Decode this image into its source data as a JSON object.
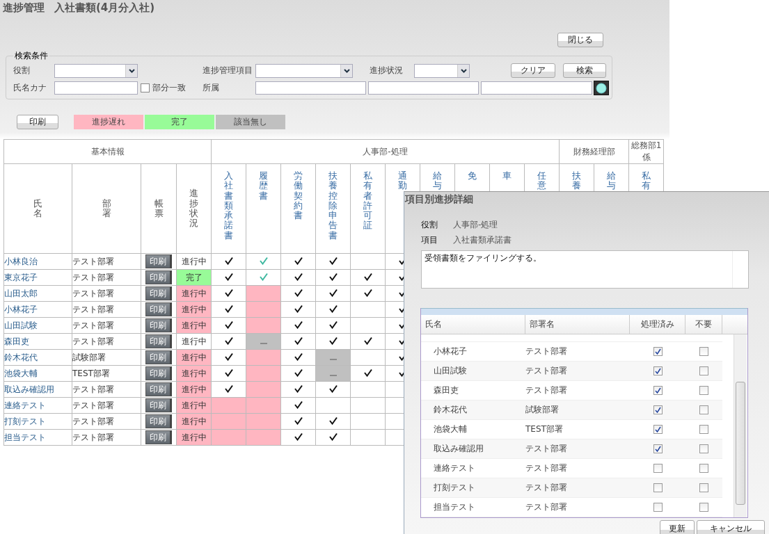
{
  "title": {
    "module": "進捗管理",
    "document": "入社書類(4月分入社)"
  },
  "close_button": "閉じる",
  "search": {
    "legend": "検索条件",
    "role_label": "役割",
    "item_label": "進捗管理項目",
    "status_label": "進捗状況",
    "kana_label": "氏名カナ",
    "partial_match": {
      "label": "部分一致",
      "checked": false
    },
    "affiliation_label": "所属",
    "buttons": [
      "クリア",
      "検索"
    ]
  },
  "legend": {
    "print_button": "印刷",
    "items": [
      {
        "label": "進捗遅れ",
        "kind": "late"
      },
      {
        "label": "完了",
        "kind": "done"
      },
      {
        "label": "該当無し",
        "kind": "na"
      }
    ]
  },
  "table": {
    "groups": [
      {
        "label": "基本情報",
        "columns": [
          "氏名",
          "部署",
          "帳票",
          "進捗状況"
        ]
      },
      {
        "label": "人事部-処理",
        "columns": [
          "入社書類承諾書",
          "履歴書",
          "労働契約書",
          "扶養控除申告書",
          "私有者許可証",
          "通勤",
          "給与",
          "免",
          "車",
          "任意"
        ]
      },
      {
        "label": "財務経理部",
        "columns": [
          "扶養",
          "給与"
        ]
      },
      {
        "label": "総務部1係",
        "columns": [
          "私有"
        ]
      }
    ],
    "rows": [
      {
        "name": "小林良治",
        "dept": "テスト部署",
        "print": "印刷",
        "status": {
          "text": "進行中",
          "kind": "normal"
        },
        "docs": [
          {
            "kind": "check"
          },
          {
            "kind": "confirmed"
          },
          {
            "kind": "check"
          },
          {
            "kind": "check"
          },
          {
            "kind": "blank"
          },
          {
            "kind": "check"
          }
        ]
      },
      {
        "name": "東京花子",
        "dept": "テスト部署",
        "print": "印刷",
        "status": {
          "text": "完了",
          "kind": "done"
        },
        "docs": [
          {
            "kind": "check"
          },
          {
            "kind": "confirmed"
          },
          {
            "kind": "check"
          },
          {
            "kind": "check"
          },
          {
            "kind": "check"
          },
          {
            "kind": "check"
          }
        ]
      },
      {
        "name": "山田太郎",
        "dept": "テスト部署",
        "print": "印刷",
        "status": {
          "text": "進行中",
          "kind": "late"
        },
        "docs": [
          {
            "kind": "check"
          },
          {
            "kind": "late"
          },
          {
            "kind": "check"
          },
          {
            "kind": "check"
          },
          {
            "kind": "check"
          },
          {
            "kind": "check"
          }
        ]
      },
      {
        "name": "小林花子",
        "dept": "テスト部署",
        "print": "印刷",
        "status": {
          "text": "進行中",
          "kind": "late"
        },
        "docs": [
          {
            "kind": "check"
          },
          {
            "kind": "late"
          },
          {
            "kind": "check"
          },
          {
            "kind": "check"
          },
          {
            "kind": "blank"
          },
          {
            "kind": "check"
          }
        ]
      },
      {
        "name": "山田試験",
        "dept": "テスト部署",
        "print": "印刷",
        "status": {
          "text": "進行中",
          "kind": "late"
        },
        "docs": [
          {
            "kind": "check"
          },
          {
            "kind": "late"
          },
          {
            "kind": "check"
          },
          {
            "kind": "check"
          },
          {
            "kind": "blank"
          },
          {
            "kind": "check"
          }
        ]
      },
      {
        "name": "森田吏",
        "dept": "テスト部署",
        "print": "印刷",
        "status": {
          "text": "進行中",
          "kind": "normal"
        },
        "docs": [
          {
            "kind": "check"
          },
          {
            "kind": "na"
          },
          {
            "kind": "check"
          },
          {
            "kind": "check"
          },
          {
            "kind": "check"
          },
          {
            "kind": "check"
          }
        ]
      },
      {
        "name": "鈴木花代",
        "dept": "試験部署",
        "print": "印刷",
        "status": {
          "text": "進行中",
          "kind": "late"
        },
        "docs": [
          {
            "kind": "check"
          },
          {
            "kind": "late"
          },
          {
            "kind": "check"
          },
          {
            "kind": "na"
          },
          {
            "kind": "blank"
          },
          {
            "kind": "check"
          }
        ]
      },
      {
        "name": "池袋大輔",
        "dept": "TEST部署",
        "print": "印刷",
        "status": {
          "text": "進行中",
          "kind": "late"
        },
        "docs": [
          {
            "kind": "check"
          },
          {
            "kind": "late"
          },
          {
            "kind": "check"
          },
          {
            "kind": "na"
          },
          {
            "kind": "check"
          },
          {
            "kind": "check"
          }
        ]
      },
      {
        "name": "取込み確認用",
        "dept": "テスト部署",
        "print": "印刷",
        "status": {
          "text": "進行中",
          "kind": "late"
        },
        "docs": [
          {
            "kind": "check"
          },
          {
            "kind": "late"
          },
          {
            "kind": "check"
          },
          {
            "kind": "check"
          },
          {
            "kind": "blank"
          },
          {
            "kind": "blank"
          }
        ]
      },
      {
        "name": "連絡テスト",
        "dept": "テスト部署",
        "print": "印刷",
        "status": {
          "text": "進行中",
          "kind": "late"
        },
        "docs": [
          {
            "kind": "late"
          },
          {
            "kind": "late"
          },
          {
            "kind": "check"
          },
          {
            "kind": "blank"
          },
          {
            "kind": "blank"
          },
          {
            "kind": "blank"
          }
        ]
      },
      {
        "name": "打刻テスト",
        "dept": "テスト部署",
        "print": "印刷",
        "status": {
          "text": "進行中",
          "kind": "late"
        },
        "docs": [
          {
            "kind": "late"
          },
          {
            "kind": "late"
          },
          {
            "kind": "check"
          },
          {
            "kind": "check"
          },
          {
            "kind": "blank"
          },
          {
            "kind": "blank"
          }
        ]
      },
      {
        "name": "担当テスト",
        "dept": "テスト部署",
        "print": "印刷",
        "status": {
          "text": "進行中",
          "kind": "late"
        },
        "docs": [
          {
            "kind": "late"
          },
          {
            "kind": "late"
          },
          {
            "kind": "check"
          },
          {
            "kind": "check"
          },
          {
            "kind": "blank"
          },
          {
            "kind": "blank"
          }
        ]
      }
    ]
  },
  "dialog": {
    "title": "項目別進捗詳細",
    "role_label": "役割",
    "role": "人事部-処理",
    "item_label": "項目",
    "item": "入社書類承諾書",
    "note": "受領書類をファイリングする。",
    "columns": [
      "氏名",
      "部署名",
      "処理済み",
      "不要"
    ],
    "rows": [
      {
        "name": "小林花子",
        "dept": "テスト部署",
        "processed": true,
        "unneeded": false
      },
      {
        "name": "山田試験",
        "dept": "テスト部署",
        "processed": true,
        "unneeded": false
      },
      {
        "name": "森田吏",
        "dept": "テスト部署",
        "processed": true,
        "unneeded": false
      },
      {
        "name": "鈴木花代",
        "dept": "試験部署",
        "processed": true,
        "unneeded": false
      },
      {
        "name": "池袋大輔",
        "dept": "TEST部署",
        "processed": true,
        "unneeded": false
      },
      {
        "name": "取込み確認用",
        "dept": "テスト部署",
        "processed": true,
        "unneeded": false
      },
      {
        "name": "連絡テスト",
        "dept": "テスト部署",
        "processed": false,
        "unneeded": false
      },
      {
        "name": "打刻テスト",
        "dept": "テスト部署",
        "processed": false,
        "unneeded": false
      },
      {
        "name": "担当テスト",
        "dept": "テスト部署",
        "processed": false,
        "unneeded": false
      }
    ],
    "buttons": [
      "更新",
      "キャンセル"
    ]
  }
}
